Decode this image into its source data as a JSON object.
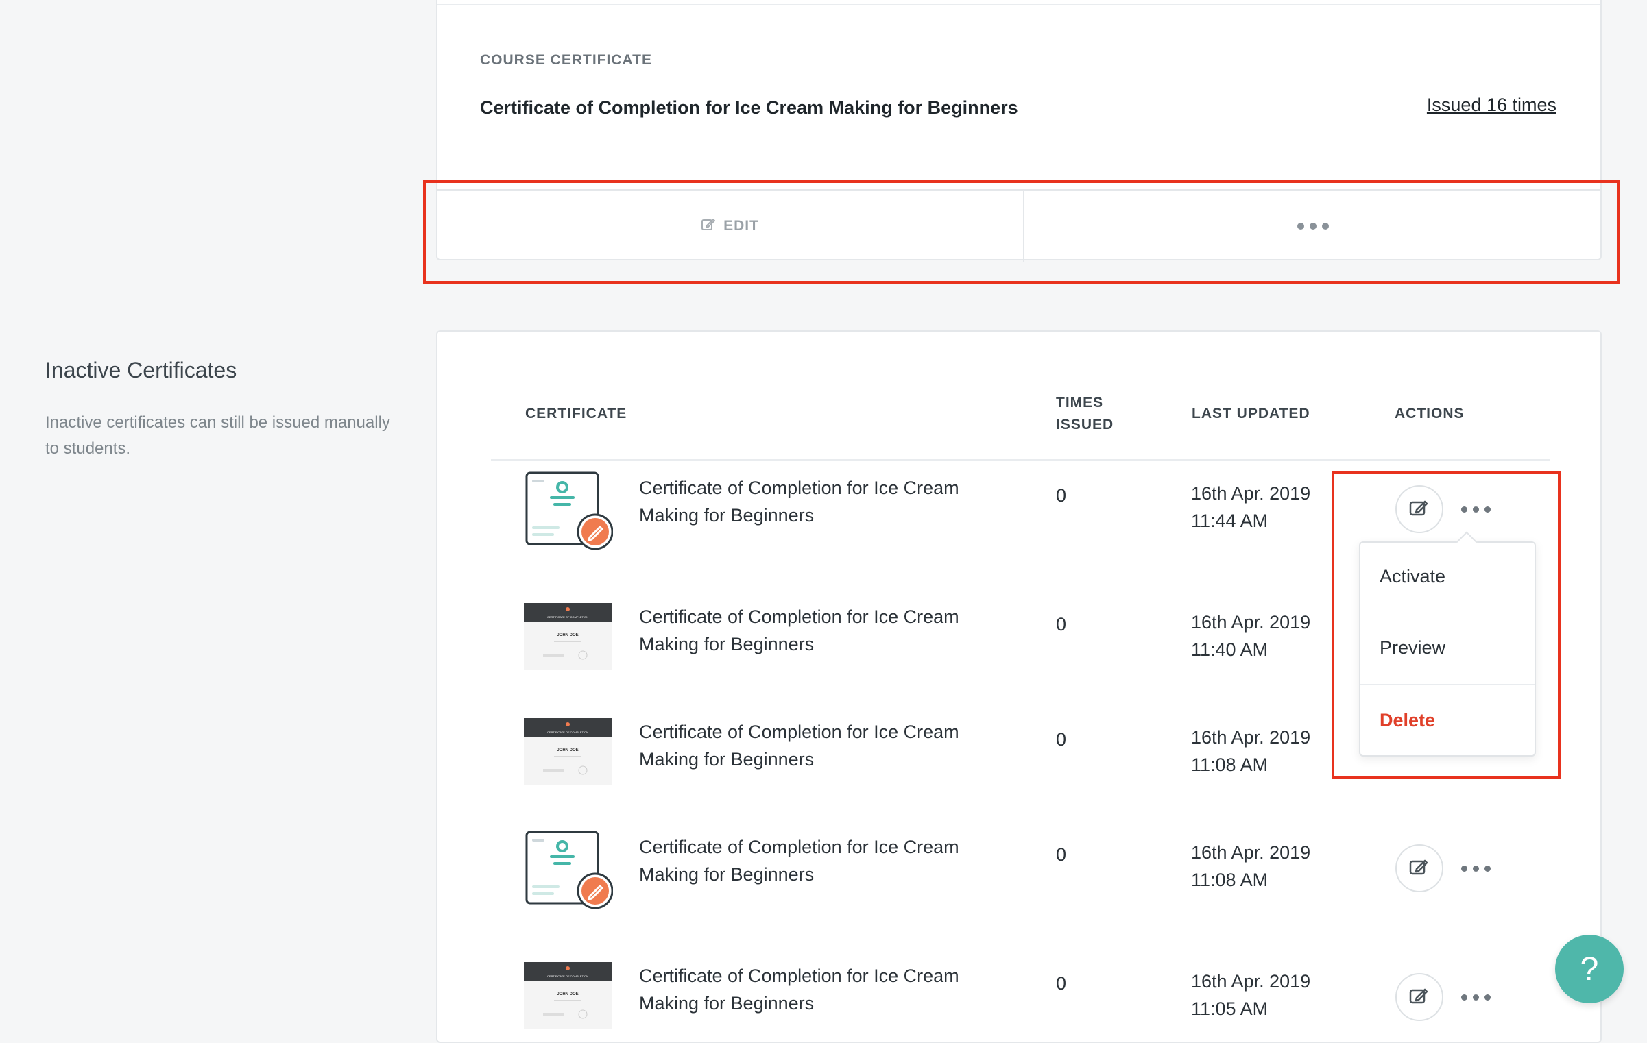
{
  "active_certificate": {
    "eyebrow": "COURSE CERTIFICATE",
    "name": "Certificate of Completion for Ice Cream Making for Beginners",
    "issued_link": "Issued 16 times",
    "edit_label": "EDIT"
  },
  "inactive_section": {
    "title": "Inactive Certificates",
    "description": "Inactive certificates can still be issued manually to students."
  },
  "table": {
    "headers": {
      "certificate": "CERTIFICATE",
      "times_issued_line1": "TIMES",
      "times_issued_line2": "ISSUED",
      "last_updated": "LAST UPDATED",
      "actions": "ACTIONS"
    },
    "rows": [
      {
        "thumb": "blank-certificate-icon",
        "name_line1": "Certificate of Completion for Ice Cream",
        "name_line2": "Making for Beginners",
        "times_issued": "0",
        "date": "16th Apr. 2019",
        "time": "11:44 AM"
      },
      {
        "thumb": "certificate-preview-image",
        "name_line1": "Certificate of Completion for Ice Cream",
        "name_line2": "Making for Beginners",
        "times_issued": "0",
        "date": "16th Apr. 2019",
        "time": "11:40 AM"
      },
      {
        "thumb": "certificate-preview-image",
        "name_line1": "Certificate of Completion for Ice Cream",
        "name_line2": "Making for Beginners",
        "times_issued": "0",
        "date": "16th Apr. 2019",
        "time": "11:08 AM"
      },
      {
        "thumb": "blank-certificate-icon",
        "name_line1": "Certificate of Completion for Ice Cream",
        "name_line2": "Making for Beginners",
        "times_issued": "0",
        "date": "16th Apr. 2019",
        "time": "11:08 AM"
      },
      {
        "thumb": "certificate-preview-image",
        "name_line1": "Certificate of Completion for Ice Cream",
        "name_line2": "Making for Beginners",
        "times_issued": "0",
        "date": "16th Apr. 2019",
        "time": "11:05 AM"
      }
    ],
    "preview_text": {
      "name": "JOHN DOE",
      "heading": "CERTIFICATE OF COMPLETION"
    }
  },
  "dropdown": {
    "activate": "Activate",
    "preview": "Preview",
    "delete": "Delete"
  },
  "help_button": {
    "label": "?"
  },
  "colors": {
    "accent_teal": "#4fb7aa",
    "delete_red": "#e0402a",
    "highlight_red": "#e8321e",
    "edit_badge_orange": "#f07b4f"
  }
}
